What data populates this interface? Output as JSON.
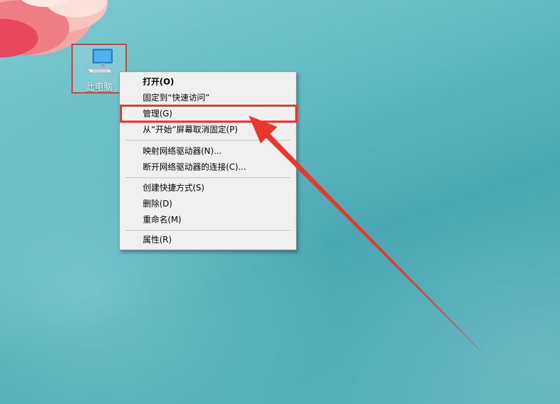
{
  "desktop": {
    "icon": {
      "label": "此电脑",
      "icon_name": "computer-icon"
    }
  },
  "context_menu": {
    "items": [
      {
        "label": "打开(O)",
        "bold": true
      },
      {
        "label": "固定到“快速访问”"
      },
      {
        "label": "管理(G)",
        "highlighted": true
      },
      {
        "label": "从“开始”屏幕取消固定(P)"
      },
      {
        "label": "映射网络驱动器(N)..."
      },
      {
        "label": "断开网络驱动器的连接(C)..."
      },
      {
        "label": "创建快捷方式(S)"
      },
      {
        "label": "删除(D)"
      },
      {
        "label": "重命名(M)"
      },
      {
        "label": "属性(R)"
      }
    ]
  },
  "annotation": {
    "color": "#e8372b",
    "arrow_icon": "red-arrow-icon"
  }
}
